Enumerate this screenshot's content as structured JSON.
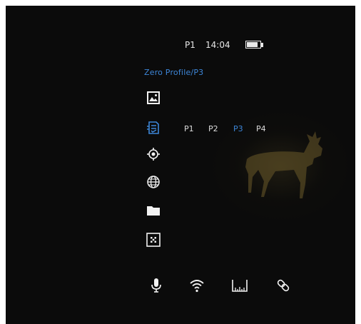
{
  "status_bar": {
    "profile": "P1",
    "time": "14:04",
    "battery_level": 0.75
  },
  "menu": {
    "title": "Zero Profile/P3",
    "items": [
      {
        "icon": "image-icon",
        "state": "normal"
      },
      {
        "icon": "zero-profile-icon",
        "state": "selected"
      },
      {
        "icon": "crosshair-icon",
        "state": "normal"
      },
      {
        "icon": "globe-icon",
        "state": "normal"
      },
      {
        "icon": "folder-icon",
        "state": "normal"
      },
      {
        "icon": "pixel-repair-icon",
        "state": "normal"
      }
    ],
    "profile_options": [
      "P1",
      "P2",
      "P3",
      "P4"
    ],
    "selected_profile": "P3"
  },
  "bottom_bar": {
    "icons": [
      "microphone-icon",
      "wifi-icon",
      "rangefinder-icon",
      "link-icon"
    ]
  },
  "colors": {
    "accent": "#3d86d8",
    "foreground": "#e8e8e8",
    "background": "#0b0b0b"
  }
}
